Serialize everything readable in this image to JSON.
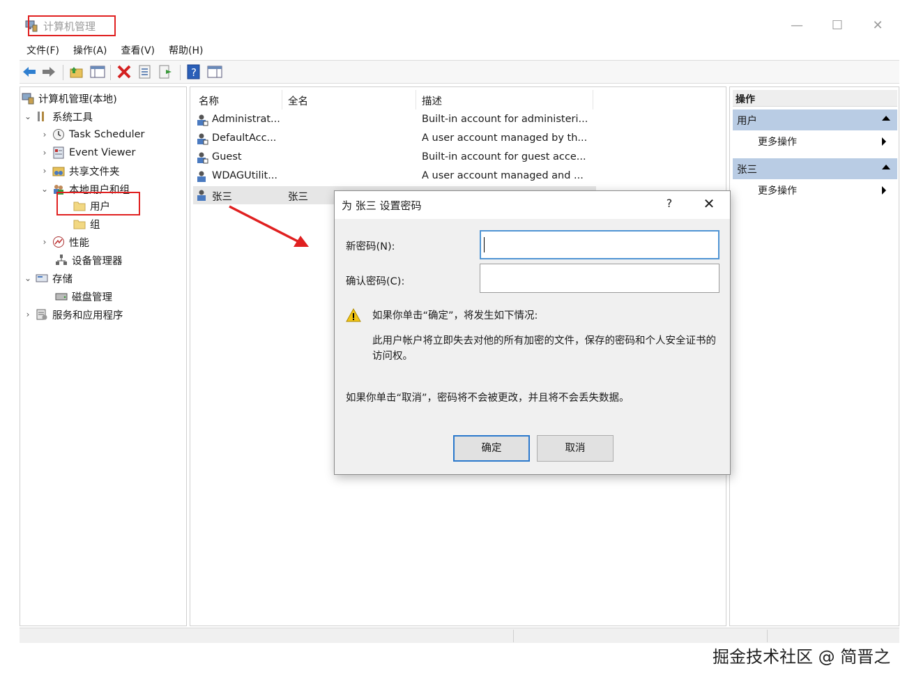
{
  "window": {
    "title": "计算机管理",
    "min_label": "—",
    "max_label": "☐",
    "close_label": "✕"
  },
  "menu": [
    "文件(F)",
    "操作(A)",
    "查看(V)",
    "帮助(H)"
  ],
  "tree": {
    "root": "计算机管理(本地)",
    "system_tools": "系统工具",
    "task_scheduler": "Task Scheduler",
    "event_viewer": "Event Viewer",
    "shared_folders": "共享文件夹",
    "local_users_groups": "本地用户和组",
    "users": "用户",
    "groups": "组",
    "performance": "性能",
    "device_manager": "设备管理器",
    "storage": "存储",
    "disk_management": "磁盘管理",
    "services_apps": "服务和应用程序"
  },
  "list": {
    "columns": [
      "名称",
      "全名",
      "描述"
    ],
    "rows": [
      {
        "name": "Administrat...",
        "fullname": "",
        "desc": "Built-in account for administeri..."
      },
      {
        "name": "DefaultAcc...",
        "fullname": "",
        "desc": "A user account managed by th..."
      },
      {
        "name": "Guest",
        "fullname": "",
        "desc": "Built-in account for guest acce..."
      },
      {
        "name": "WDAGUtilit...",
        "fullname": "",
        "desc": "A user account managed and ..."
      },
      {
        "name": "张三",
        "fullname": "张三",
        "desc": ""
      }
    ]
  },
  "actions": {
    "title": "操作",
    "section1": "用户",
    "section1_more": "更多操作",
    "section2": "张三",
    "section2_more": "更多操作"
  },
  "dialog": {
    "title": "为 张三 设置密码",
    "help": "?",
    "close": "✕",
    "new_password_label": "新密码(N):",
    "new_password_value": "",
    "confirm_password_label": "确认密码(C):",
    "confirm_password_value": "",
    "warning_line": "如果你单击“确定”，将发生如下情况:",
    "warning_detail": "此用户帐户将立即失去对他的所有加密的文件，保存的密码和个人安全证书的访问权。",
    "cancel_note": "如果你单击“取消”，密码将不会被更改，并且将不会丢失数据。",
    "ok_label": "确定",
    "cancel_label": "取消"
  },
  "watermark": "掘金技术社区 @ 简晋之"
}
